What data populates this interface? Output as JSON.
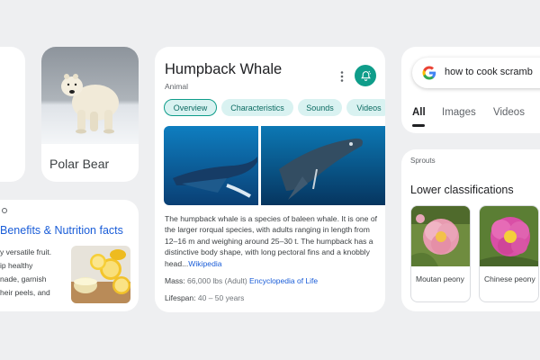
{
  "polar_bear": {
    "label": "Polar Bear"
  },
  "lemon": {
    "title": "Benefits & Nutrition facts",
    "lines": [
      "y versatile fruit.",
      "ip healthy",
      "nade, garnish",
      "heir peels, and"
    ]
  },
  "whale": {
    "title": "Humpback Whale",
    "subtitle": "Animal",
    "chips": [
      "Overview",
      "Characteristics",
      "Sounds",
      "Videos"
    ],
    "description": "The humpback whale is a species of baleen whale. It is one of the larger rorqual species, with adults ranging in length from 12–16 m and weighing around 25–30 t. The humpback has a distinctive body shape, with long pectoral fins and a knobbly head...",
    "description_link": "Wikipedia",
    "mass_label": "Mass:",
    "mass_value": "66,000 lbs (Adult)",
    "mass_link": "Encyclopedia of Life",
    "lifespan_label": "Lifespan:",
    "lifespan_value": "40 – 50 years",
    "icons": {
      "more": "more-vert-icon",
      "alert": "bell-alert-icon"
    },
    "colors": {
      "accent": "#0f9d8a",
      "chip_bg": "#d9f2f1",
      "link": "#1a5dd8"
    }
  },
  "search": {
    "query": "how to cook scramb",
    "tabs": [
      "All",
      "Images",
      "Videos"
    ],
    "active_tab": "All",
    "logo_icon": "google-g-icon"
  },
  "sprouts": {
    "source": "Sprouts",
    "heading": "Lower classifications",
    "items": [
      {
        "label": "Moutan peony"
      },
      {
        "label": "Chinese peony"
      }
    ]
  }
}
